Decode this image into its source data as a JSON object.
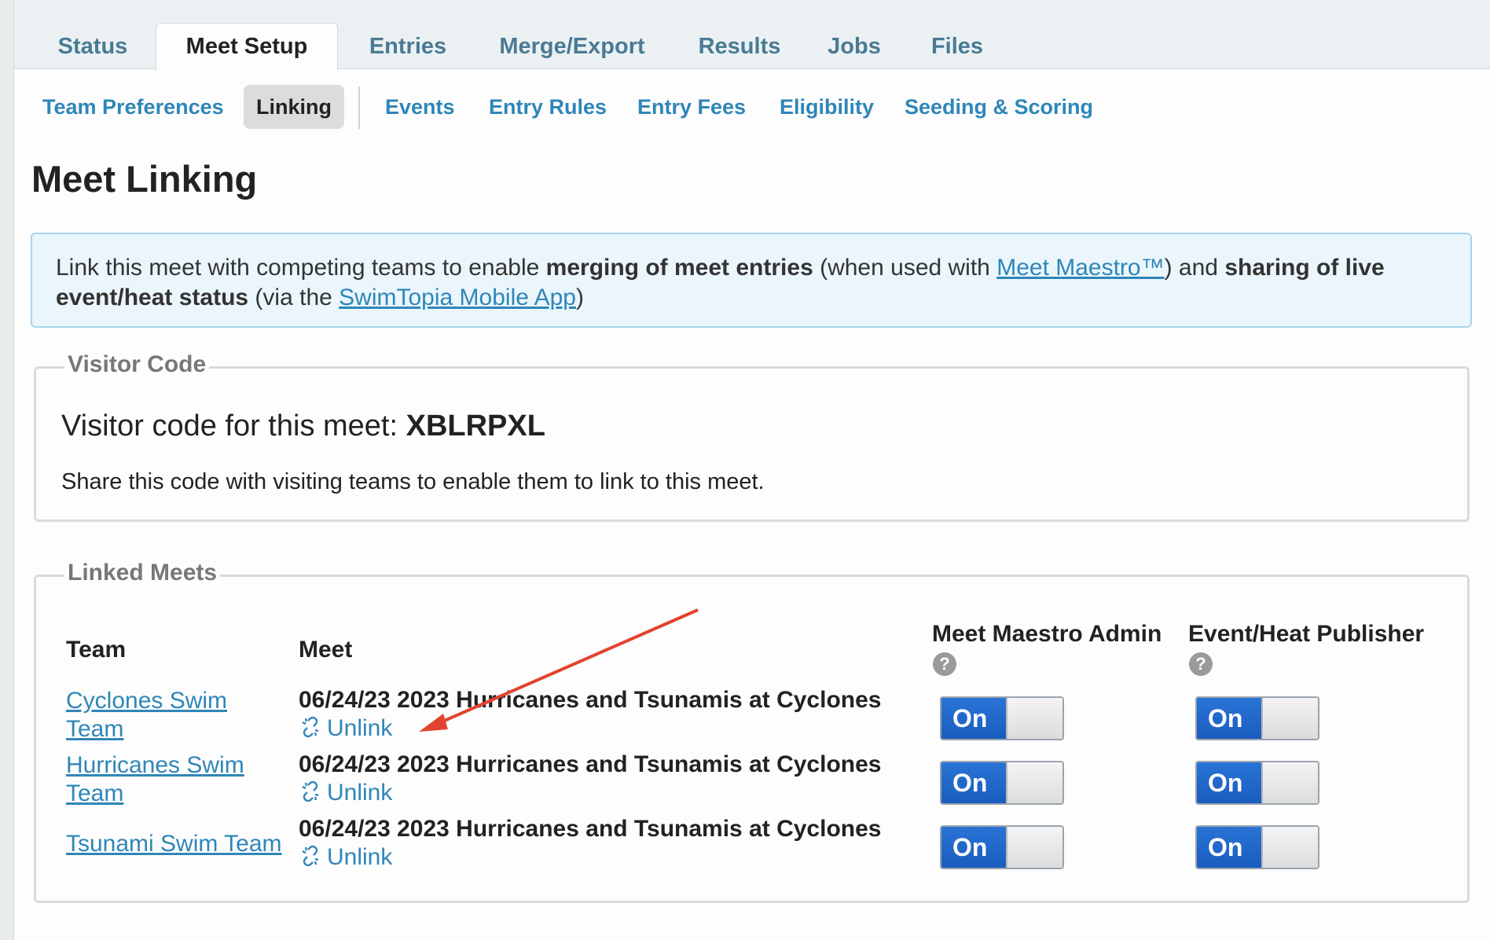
{
  "tabs": [
    "Status",
    "Meet Setup",
    "Entries",
    "Merge/Export",
    "Results",
    "Jobs",
    "Files"
  ],
  "active_tab": "Meet Setup",
  "subnav": [
    "Team Preferences",
    "Linking",
    "Events",
    "Entry Rules",
    "Entry Fees",
    "Eligibility",
    "Seeding & Scoring"
  ],
  "active_subnav": "Linking",
  "page_title": "Meet Linking",
  "info": {
    "t1": "Link this meet with competing teams to enable ",
    "b1": "merging of meet entries",
    "t2": " (when used with ",
    "link1": "Meet Maestro™",
    "t3": ") and ",
    "b2": "sharing of live event/heat status",
    "t4": " (via the ",
    "link2": "SwimTopia Mobile App",
    "t5": ")"
  },
  "visitor_code": {
    "legend": "Visitor Code",
    "label": "Visitor code for this meet: ",
    "code": "XBLRPXL",
    "share_text": "Share this code with visiting teams to enable them to link to this meet."
  },
  "linked_meets": {
    "legend": "Linked Meets",
    "headers": {
      "team": "Team",
      "meet": "Meet",
      "maestro": "Meet Maestro Admin",
      "publisher": "Event/Heat Publisher"
    },
    "help_glyph": "?",
    "unlink_label": "Unlink",
    "toggle_on_label": "On",
    "rows": [
      {
        "team_line1": "Cyclones Swim",
        "team_line2": "Team",
        "meet": "06/24/23 2023 Hurricanes and Tsunamis at Cyclones",
        "maestro_on": true,
        "publisher_on": true
      },
      {
        "team_line1": "Hurricanes Swim",
        "team_line2": "Team",
        "meet": "06/24/23 2023 Hurricanes and Tsunamis at Cyclones",
        "maestro_on": true,
        "publisher_on": true
      },
      {
        "team_line1": "Tsunami Swim Team",
        "team_line2": "",
        "meet": "06/24/23 2023 Hurricanes and Tsunamis at Cyclones",
        "maestro_on": true,
        "publisher_on": true
      }
    ]
  },
  "annotation_color": "#e2432f",
  "link_color": "#2f86b8"
}
